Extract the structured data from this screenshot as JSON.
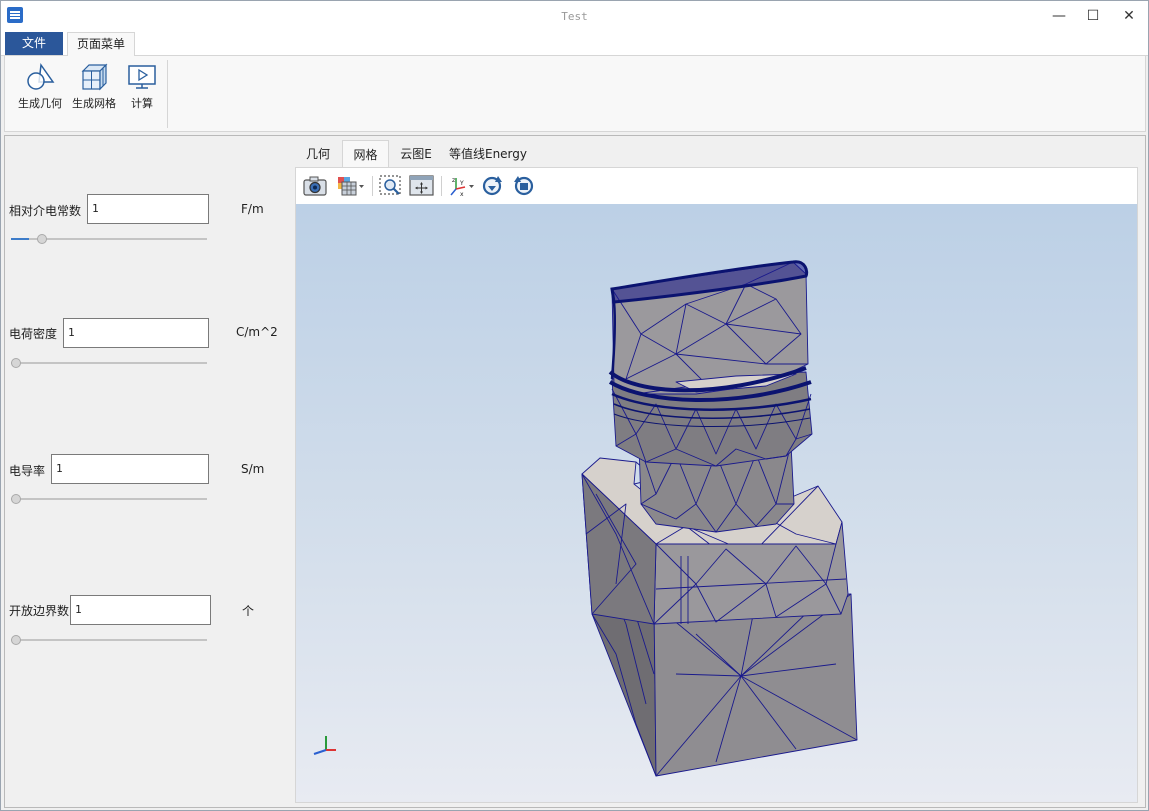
{
  "window": {
    "title": "Test"
  },
  "titlebar": {
    "minimize_glyph": "—",
    "maximize_glyph": "☐",
    "close_glyph": "✕"
  },
  "ribbon": {
    "tabs": [
      {
        "label": "文件"
      },
      {
        "label": "页面菜单"
      }
    ],
    "buttons": [
      {
        "label": "生成几何",
        "icon": "geometry-icon"
      },
      {
        "label": "生成网格",
        "icon": "mesh-icon"
      },
      {
        "label": "计算",
        "icon": "compute-icon"
      }
    ]
  },
  "params": [
    {
      "label": "相对介电常数",
      "value": "1",
      "unit": "F/m",
      "slider_fraction": 0.09
    },
    {
      "label": "电荷密度",
      "value": "1",
      "unit": "C/m^2",
      "slider_fraction": 0.0
    },
    {
      "label": "电导率",
      "value": "1",
      "unit": "S/m",
      "slider_fraction": 0.0
    },
    {
      "label": "开放边界数",
      "value": "1",
      "unit": "个",
      "slider_fraction": 0.0
    }
  ],
  "view_tabs": [
    {
      "label": "几何"
    },
    {
      "label": "网格"
    },
    {
      "label": "云图E"
    },
    {
      "label": "等值线Energy"
    }
  ],
  "active_view_tab": "网格",
  "toolbar": {
    "buttons": [
      "camera-icon",
      "display-mode-icon",
      "zoom-box-icon",
      "fit-view-icon",
      "axes-orient-icon",
      "rotate-cw-icon",
      "rotate-ccw-icon"
    ]
  },
  "colors": {
    "accent": "#2b579a",
    "mesh_line": "#1a1a8c",
    "mesh_fill": "#8c8a8d",
    "bg_top": "#bcd0e6",
    "bg_bottom": "#e8ebf2"
  },
  "axes": {
    "x": "x",
    "y": "y",
    "z": "z"
  }
}
